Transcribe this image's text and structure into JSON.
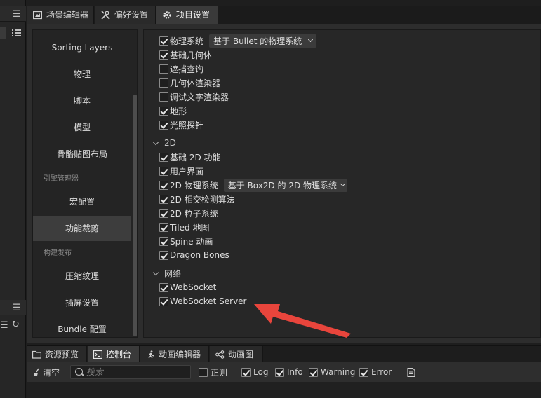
{
  "top_tabs": [
    {
      "label": "场景编辑器",
      "icon": "scene-icon"
    },
    {
      "label": "偏好设置",
      "icon": "tools-icon"
    },
    {
      "label": "项目设置",
      "icon": "gear-icon"
    }
  ],
  "nav": {
    "items": [
      {
        "label": "Sorting Layers"
      },
      {
        "label": "物理"
      },
      {
        "label": "脚本"
      },
      {
        "label": "模型"
      },
      {
        "label": "骨骼贴图布局"
      }
    ],
    "group_engine": "引擎管理器",
    "engine_items": [
      {
        "label": "宏配置"
      },
      {
        "label": "功能裁剪"
      }
    ],
    "group_build": "构建发布",
    "build_items": [
      {
        "label": "压缩纹理"
      },
      {
        "label": "插屏设置"
      },
      {
        "label": "Bundle 配置"
      }
    ]
  },
  "modules": {
    "physics": {
      "label": "物理系统",
      "checked": true,
      "select_value": "基于 Bullet 的物理系统"
    },
    "general": [
      {
        "label": "基础几何体",
        "checked": true
      },
      {
        "label": "遮挡查询",
        "checked": false
      },
      {
        "label": "几何体渲染器",
        "checked": false
      },
      {
        "label": "调试文字渲染器",
        "checked": false
      },
      {
        "label": "地形",
        "checked": true
      },
      {
        "label": "光照探针",
        "checked": true
      }
    ],
    "section_2d": "2D",
    "items_2d_a": [
      {
        "label": "基础 2D 功能",
        "checked": true
      },
      {
        "label": "用户界面",
        "checked": true
      }
    ],
    "physics_2d": {
      "label": "2D 物理系统",
      "checked": true,
      "select_value": "基于 Box2D 的 2D 物理系统"
    },
    "items_2d_b": [
      {
        "label": "2D 相交检测算法",
        "checked": true
      },
      {
        "label": "2D 粒子系统",
        "checked": true
      },
      {
        "label": "Tiled 地图",
        "checked": true
      },
      {
        "label": "Spine 动画",
        "checked": true
      },
      {
        "label": "Dragon Bones",
        "checked": true
      }
    ],
    "section_network": "网络",
    "items_network": [
      {
        "label": "WebSocket",
        "checked": true
      },
      {
        "label": "WebSocket Server",
        "checked": true
      }
    ]
  },
  "bottom_tabs": [
    {
      "label": "资源预览",
      "icon": "folder-icon"
    },
    {
      "label": "控制台",
      "icon": "console-icon"
    },
    {
      "label": "动画编辑器",
      "icon": "run-icon"
    },
    {
      "label": "动画图",
      "icon": "graph-icon"
    }
  ],
  "console_toolbar": {
    "clear_label": "清空",
    "search_placeholder": "搜索",
    "regex_label": "正则",
    "regex_checked": false,
    "log_label": "Log",
    "info_label": "Info",
    "warning_label": "Warning",
    "error_label": "Error"
  },
  "colors": {
    "annotation_arrow": "#e8453c",
    "panel_bg": "#2d2d2d",
    "selected_nav": "#3d3d3d"
  }
}
